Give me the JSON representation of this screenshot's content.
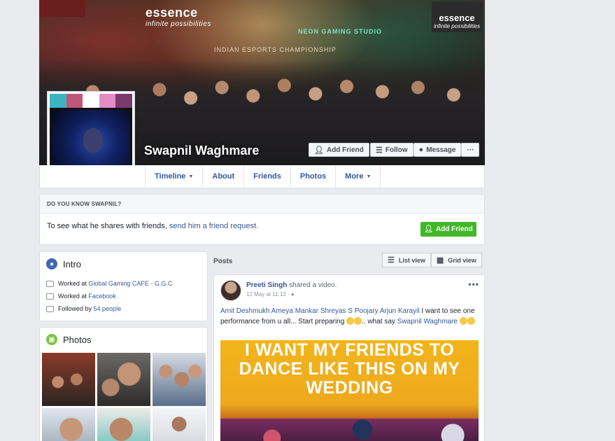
{
  "profile": {
    "name": "Swapnil Waghmare",
    "cover_banner": {
      "left_brand": "essence",
      "left_tagline": "infinite possibilities",
      "center_title": "INDIAN ESPORTS CHAMPIONSHIP",
      "neon": "NEON GAMING STUDIO",
      "right_brand": "essence",
      "right_tagline": "infinite possibilities"
    },
    "pic_stripe_colors": [
      "#3bb3c3",
      "#c0577a",
      "#ffffff",
      "#e58cc7",
      "#7b3a6e"
    ]
  },
  "cover_actions": {
    "add_friend": "Add Friend",
    "follow": "Follow",
    "message": "Message",
    "more": "···"
  },
  "nav": {
    "tabs": [
      {
        "label": "Timeline",
        "caret": true
      },
      {
        "label": "About"
      },
      {
        "label": "Friends"
      },
      {
        "label": "Photos"
      },
      {
        "label": "More",
        "caret": true
      }
    ]
  },
  "know": {
    "heading": "DO YOU KNOW SWAPNIL?",
    "text_before": "To see what he shares with friends, ",
    "link": "send him a friend request.",
    "button": "Add Friend"
  },
  "intro": {
    "title": "Intro",
    "rows": [
      {
        "prefix": "Worked at ",
        "link": "Global Gaming CAFE - G.G.C",
        "suffix": ""
      },
      {
        "prefix": "Worked at ",
        "link": "Facebook",
        "suffix": ""
      },
      {
        "prefix": "Followed by ",
        "link": "54 people",
        "suffix": ""
      }
    ]
  },
  "photos": {
    "title": "Photos"
  },
  "posts": {
    "label": "Posts",
    "list_view": "List view",
    "grid_view": "Grid view"
  },
  "post": {
    "author": "Preeti Singh",
    "action": "shared a video.",
    "time": "12 May at 11:12 · ",
    "mentions": "Amit Deshmukh Ameya Mankar Shreyas S Poojary Arjun Karayil",
    "text": " I want to see one performance from u all... Start preparing ",
    "text2": ".. what say ",
    "mention2": "Swapnil Waghmare",
    "media_text": "I WANT MY FRIENDS TO DANCE LIKE THIS ON MY WEDDING",
    "more": "•••"
  },
  "colors": {
    "fb_blue": "#365899",
    "green": "#42b72a",
    "bg": "#e9ebee"
  }
}
